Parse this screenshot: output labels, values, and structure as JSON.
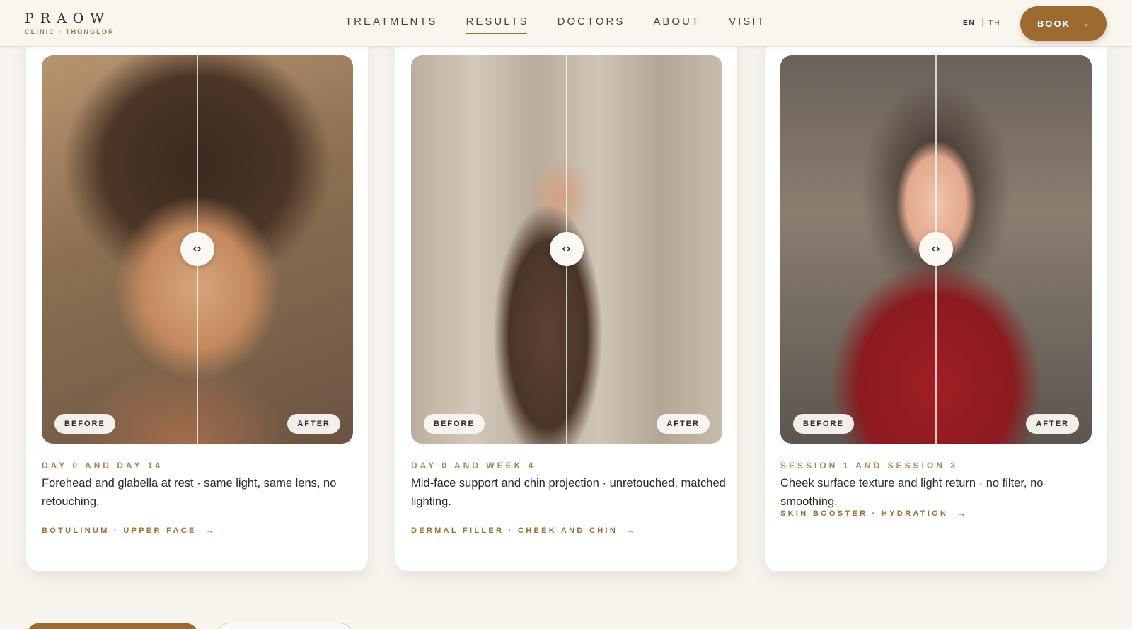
{
  "brand": {
    "name": "PRAOW",
    "subtitle": "CLINIC · THONGLOR"
  },
  "nav": {
    "items": [
      {
        "label": "TREATMENTS",
        "active": false
      },
      {
        "label": "RESULTS",
        "active": true
      },
      {
        "label": "DOCTORS",
        "active": false
      },
      {
        "label": "ABOUT",
        "active": false
      },
      {
        "label": "VISIT",
        "active": false
      }
    ]
  },
  "language": {
    "current": "EN",
    "other": "TH"
  },
  "book_button": {
    "label": "BOOK",
    "icon": "arrow-right-icon"
  },
  "colors": {
    "accent": "#9c6a2f",
    "caption_accent": "#b0854c",
    "background": "#f8f5ef"
  },
  "cards": [
    {
      "before_label": "BEFORE",
      "after_label": "AFTER",
      "handle_icon": "‹›",
      "period": "DAY 0 AND DAY 14",
      "description": "Forehead and glabella at rest · same light, same lens, no retouching.",
      "link": "BOTULINUM · UPPER FACE"
    },
    {
      "before_label": "BEFORE",
      "after_label": "AFTER",
      "handle_icon": "‹›",
      "period": "DAY 0 AND WEEK 4",
      "description": "Mid-face support and chin projection · unretouched, matched lighting.",
      "link": "DERMAL FILLER · CHEEK AND CHIN"
    },
    {
      "before_label": "BEFORE",
      "after_label": "AFTER",
      "handle_icon": "‹›",
      "period": "SESSION 1 AND SESSION 3",
      "description": "Cheek surface texture and light return · no filter, no smoothing.",
      "link": "SKIN BOOSTER · HYDRATION"
    }
  ],
  "link_arrow": "→"
}
